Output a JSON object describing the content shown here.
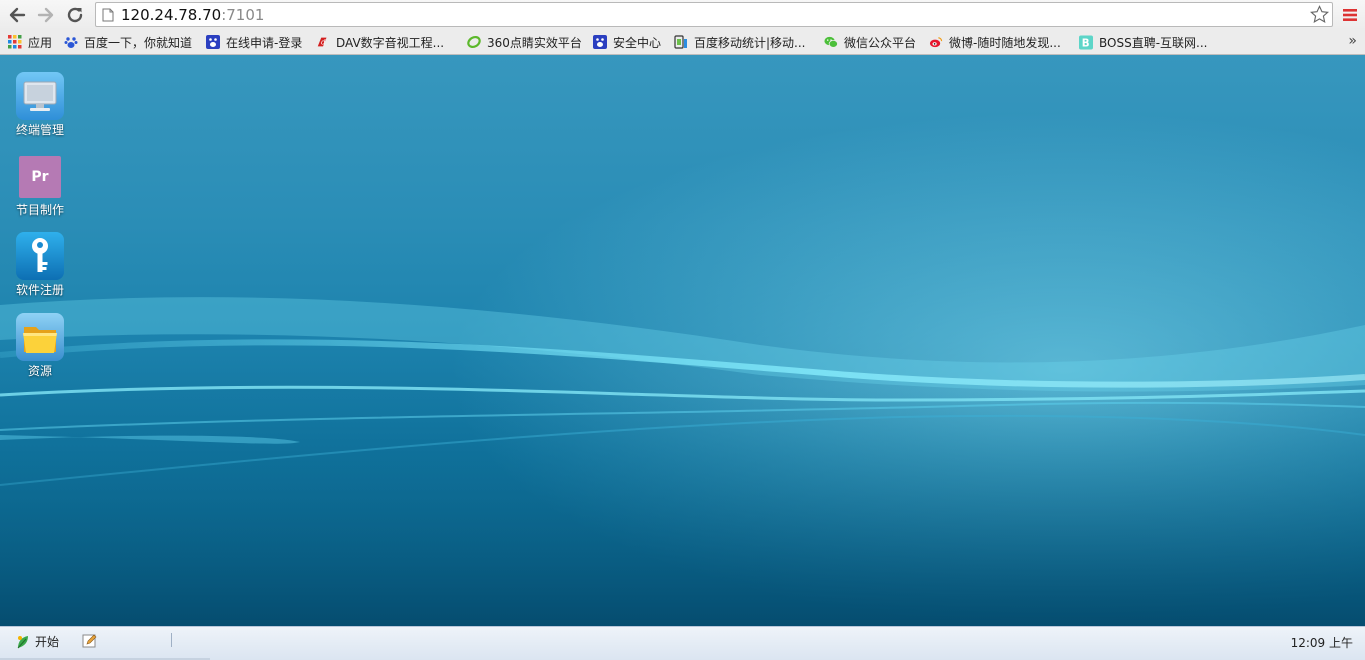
{
  "browser": {
    "url_host": "120.24.78.70",
    "url_port": ":7101"
  },
  "bookmarks": [
    {
      "label": "应用",
      "icon": "apps-grid-icon"
    },
    {
      "label": "百度一下，你就知道",
      "icon": "baidu-paw-icon"
    },
    {
      "label": "在线申请-登录",
      "icon": "baidu-paw-icon"
    },
    {
      "label": "DAV数字音视工程...",
      "icon": "dav-logo-icon"
    },
    {
      "label": "360点睛实效平台",
      "icon": "360-logo-icon"
    },
    {
      "label": "安全中心",
      "icon": "baidu-paw-icon"
    },
    {
      "label": "百度移动统计|移动...",
      "icon": "mobile-stats-icon"
    },
    {
      "label": "微信公众平台",
      "icon": "wechat-icon"
    },
    {
      "label": "微博-随时随地发现...",
      "icon": "weibo-icon"
    },
    {
      "label": "BOSS直聘-互联网...",
      "icon": "boss-logo-icon"
    }
  ],
  "desktop_icons": [
    {
      "label": "终端管理",
      "icon": "monitor-icon"
    },
    {
      "label": "节目制作",
      "icon": "premiere-pr-icon"
    },
    {
      "label": "软件注册",
      "icon": "key-icon"
    },
    {
      "label": "资源",
      "icon": "folder-icon"
    }
  ],
  "premiere_text": "Pr",
  "taskbar": {
    "start_label": "开始",
    "clock": "12:09 上午"
  },
  "colors": {
    "desktop_top": "#3797be",
    "desktop_bottom": "#075a80",
    "taskbar": "#dbe5f1"
  }
}
